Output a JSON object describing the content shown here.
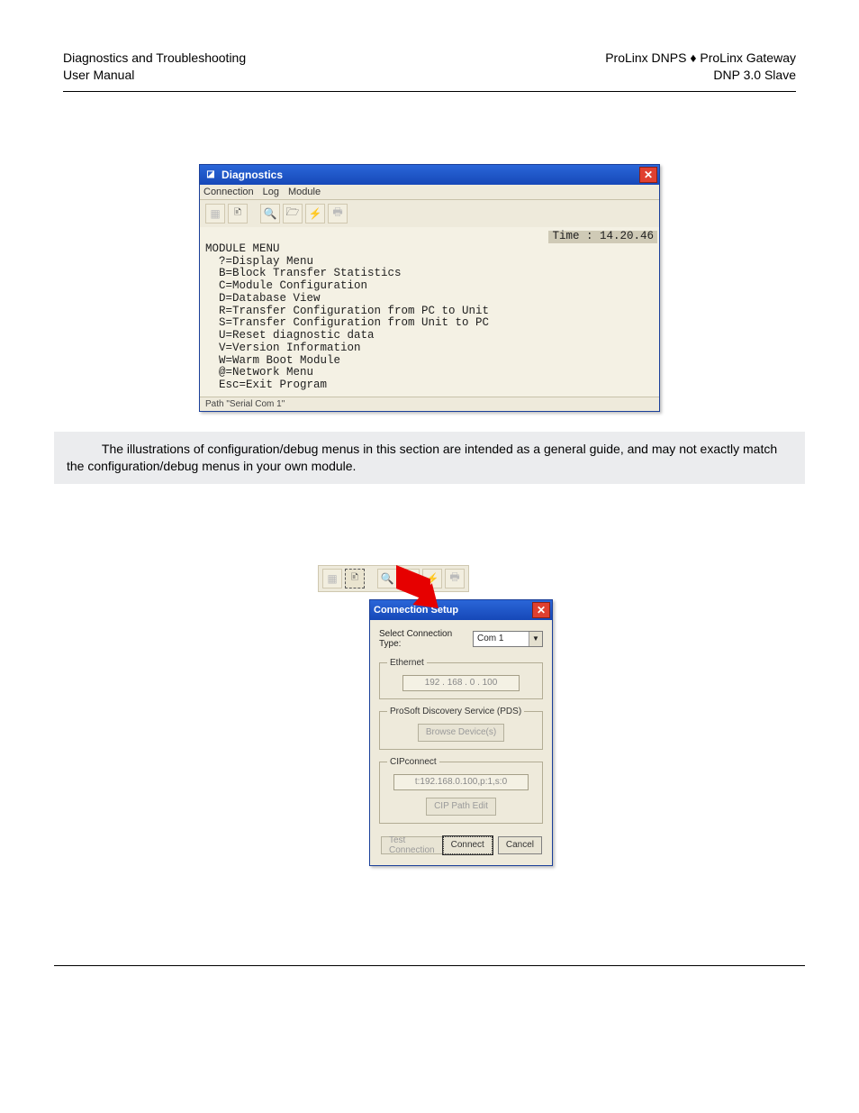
{
  "header": {
    "left1": "Diagnostics and Troubleshooting",
    "left2": "User Manual",
    "right1": "ProLinx DNPS ♦ ProLinx Gateway",
    "right2": "DNP 3.0 Slave"
  },
  "win": {
    "title": "Diagnostics",
    "menus": {
      "connection": "Connection",
      "log": "Log",
      "module": "Module"
    },
    "time": "Time : 14.20.46",
    "lines": {
      "l0": "MODULE MENU",
      "l1": "  ?=Display Menu",
      "l2": "  B=Block Transfer Statistics",
      "l3": "  C=Module Configuration",
      "l4": "  D=Database View",
      "l5": "  R=Transfer Configuration from PC to Unit",
      "l6": "  S=Transfer Configuration from Unit to PC",
      "l7": "  U=Reset diagnostic data",
      "l8": "  V=Version Information",
      "l9": "  W=Warm Boot Module",
      "l10": "  @=Network Menu",
      "l11": "  Esc=Exit Program"
    },
    "status": "Path \"Serial Com 1\""
  },
  "note": "The illustrations of configuration/debug menus in this section are intended as a general guide, and may not exactly match the configuration/debug menus in your own module.",
  "dlg": {
    "title": "Connection Setup",
    "select_label": "Select Connection Type:",
    "select_value": "Com 1",
    "ethernet": {
      "legend": "Ethernet",
      "value": "192 . 168 .   0 . 100"
    },
    "pds": {
      "legend": "ProSoft Discovery Service (PDS)",
      "button": "Browse Device(s)"
    },
    "cip": {
      "legend": "CIPconnect",
      "value": "t:192.168.0.100,p:1,s:0",
      "button": "CIP Path Edit"
    },
    "footer": {
      "test": "Test Connection",
      "connect": "Connect",
      "cancel": "Cancel"
    }
  }
}
